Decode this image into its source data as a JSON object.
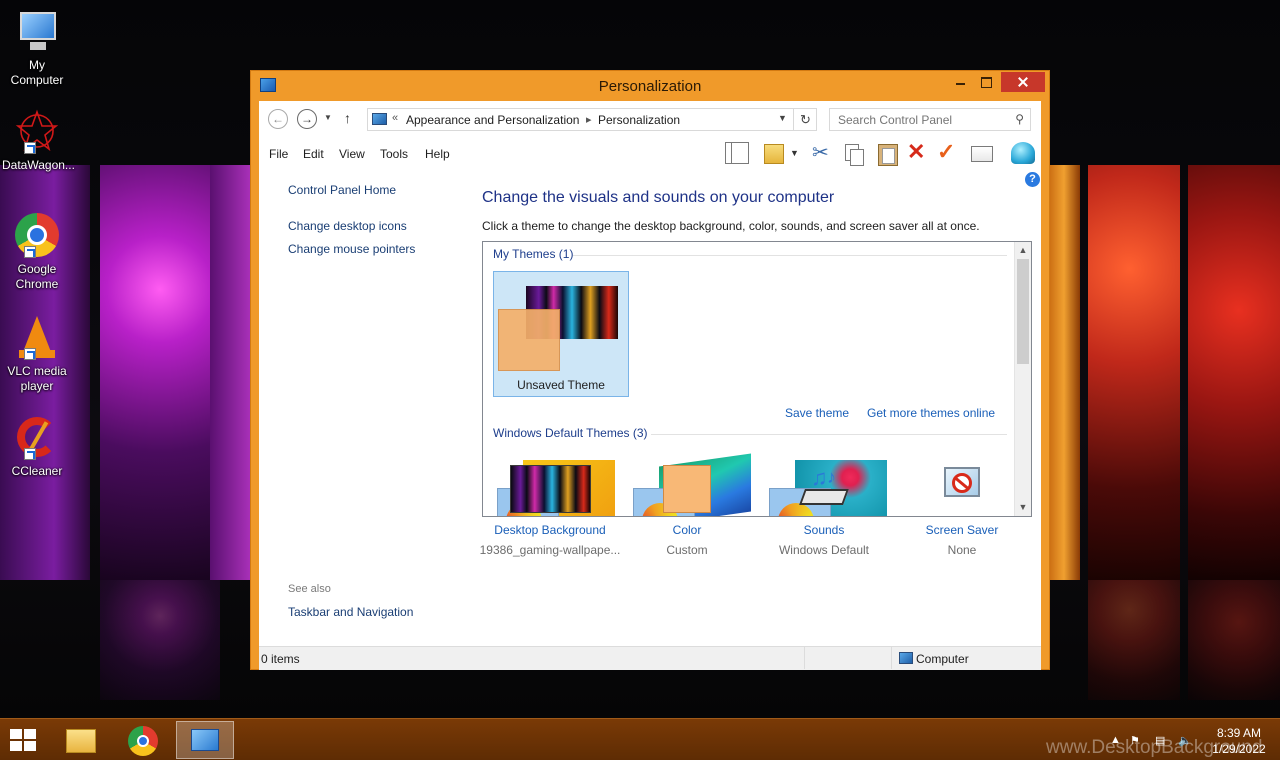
{
  "window": {
    "title": "Personalization",
    "accent": "#F09A2A"
  },
  "address": {
    "overflow": "«",
    "segments": [
      "Appearance and Personalization",
      "Personalization"
    ],
    "search_placeholder": "Search Control Panel"
  },
  "menu": [
    "File",
    "Edit",
    "View",
    "Tools",
    "Help"
  ],
  "toolbar_icons": [
    "layout-icon",
    "folder-check-icon",
    "cut-icon",
    "copy-icon",
    "paste-icon",
    "delete-icon",
    "check-icon",
    "properties-icon",
    "globe-icon"
  ],
  "left": {
    "home": "Control Panel Home",
    "links": [
      "Change desktop icons",
      "Change mouse pointers"
    ],
    "see_also_label": "See also",
    "see_also": [
      "Taskbar and Navigation"
    ]
  },
  "main": {
    "title": "Change the visuals and sounds on your computer",
    "description": "Click a theme to change the desktop background, color, sounds, and screen saver all at once.",
    "my_themes": {
      "label": "My Themes (1)",
      "selected": "Unsaved Theme"
    },
    "save_theme": "Save theme",
    "get_more": "Get more themes online",
    "default_themes": {
      "label": "Windows Default Themes (3)"
    }
  },
  "settings": [
    {
      "label": "Desktop Background",
      "value": "19386_gaming-wallpape..."
    },
    {
      "label": "Color",
      "value": "Custom"
    },
    {
      "label": "Sounds",
      "value": "Windows Default"
    },
    {
      "label": "Screen Saver",
      "value": "None"
    }
  ],
  "status": {
    "items": "0 items",
    "location": "Computer"
  },
  "desktop_icons": [
    {
      "label": "My Computer"
    },
    {
      "label": "DataWagon..."
    },
    {
      "label": "Google Chrome"
    },
    {
      "label": "VLC media player"
    },
    {
      "label": "CCleaner"
    }
  ],
  "taskbar": {
    "time": "8:39 AM",
    "date": "1/29/2022",
    "watermark": "www.DesktopBackground"
  }
}
